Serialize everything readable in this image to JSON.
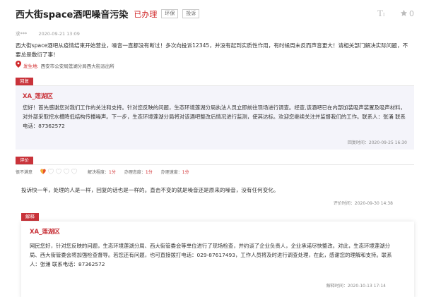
{
  "header": {
    "title": "西大街space酒吧噪音污染",
    "status": "已办理",
    "tags": [
      "环保",
      "投诉"
    ],
    "star_count": "0",
    "icons": [
      "font-size-icon",
      "star-icon"
    ]
  },
  "meta": {
    "author": "求***",
    "time": "2020-09-21 13:09"
  },
  "content": "西大街space酒吧从疫情结束开始营业，噪音一直都没有断过！多次向投诉12345，并没有起到实质性作用，有时候周末反而声音更大！请相关部门解决实际问题，不要总是敷衍了事！",
  "address": {
    "label": "发生地:",
    "value": "西安市公安局莲湖分局西大街派出所"
  },
  "reply": {
    "tab": "回复",
    "org": "XA_莲湖区",
    "text": "您好！首先感谢您对我们工作的关注和支持。针对您反映的问题，生态环境莲湖分局执法人员立即前往现场进行调查。经查,该酒吧已在内部加装吸声装置及吸声材料，对外部采取挖水槽降低结构传播噪声。下一步，生态环境莲湖分局将对该酒吧整改后情况进行监测，使其达标。欢迎您继续关注并监督我们的工作。联系人：张涌 联系电话：87362572",
    "time_label": "回复时间：",
    "time": "2020-09-25 16:30"
  },
  "evaluation": {
    "tab": "评价",
    "label": "很不满意",
    "hearts_filled": 1,
    "hearts_total": 5,
    "scores": [
      {
        "label": "解决程度：",
        "value": "1分"
      },
      {
        "label": "办理态度：",
        "value": "1分"
      },
      {
        "label": "办理速度：",
        "value": "1分"
      }
    ],
    "text": "投诉快一年，处理的人是一样，回复的话也是一样的。直击不变的就是噪音还是原来的噪音，没有任何变化。",
    "time_label": "评价时间：",
    "time": "2020-09-30 14:38"
  },
  "explanation": {
    "tab": "解释",
    "org": "XA_莲湖区",
    "text": "网民您好，针对您反映的问题，生态环境莲湖分局、西大街管委会等单位进行了现场检查，并约谈了企业负责人，企业承诺尽快整改。对此，生态环境莲湖分局、西大街管委会将加强检查督导。若您还有问题，也可直接拨打电话：029-87617493，工作人员将及时进行调查处理，在此，感谢您的理解和支持。联系人：张涌 联系电话：87362572",
    "time_label": "解释时间：",
    "time": "2020-10-13 17:14"
  },
  "colors": {
    "accent": "#c9333a",
    "status": "#d0282a",
    "reply_bg": "#f4f4fa"
  }
}
